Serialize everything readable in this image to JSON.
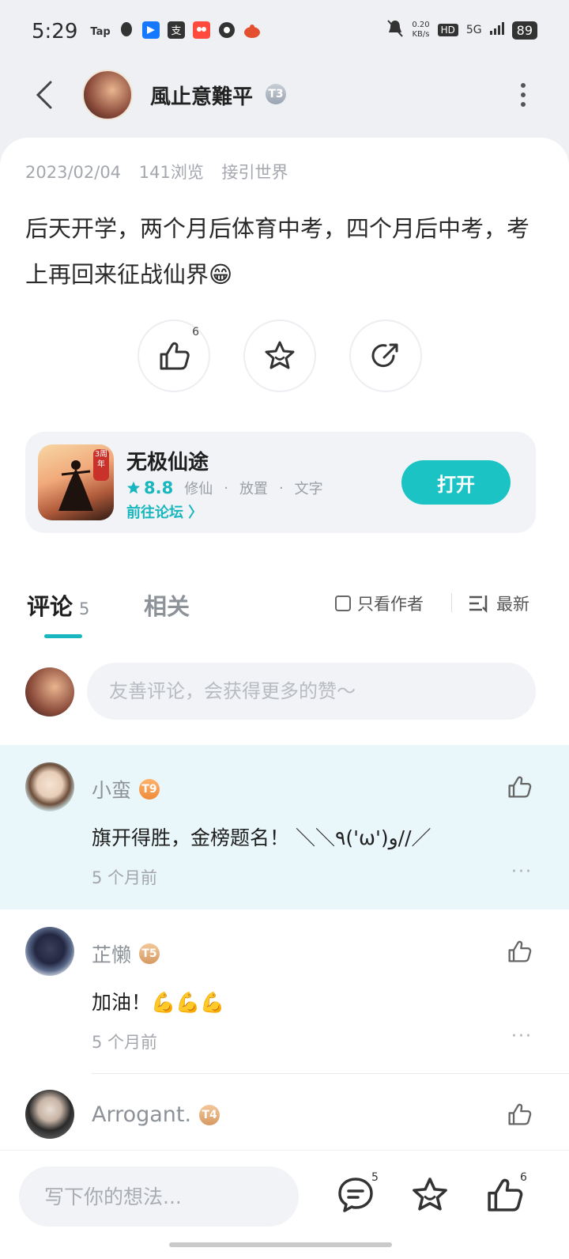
{
  "status_bar": {
    "time": "5:29",
    "app_icons": [
      "Tap",
      "QQ",
      "Alipay",
      "支",
      "Taobao",
      "Browser",
      "Game"
    ],
    "net_speed": "0.20",
    "net_unit": "KB/s",
    "hd": "HD",
    "signal": "5G",
    "battery": "89"
  },
  "header": {
    "username": "風止意難平",
    "badge": "T3"
  },
  "post": {
    "date": "2023/02/04",
    "views": "141浏览",
    "forum": "接引世界",
    "content": "后天开学，两个月后体育中考，四个月后中考，考上再回来征战仙界😁",
    "like_count": "6"
  },
  "game": {
    "name": "无极仙途",
    "rating": "8.8",
    "tags": [
      "修仙",
      "放置",
      "文字"
    ],
    "forum_link": "前往论坛 〉",
    "open_label": "打开",
    "anniversary": "3周年"
  },
  "comments_section": {
    "tab_comments": "评论",
    "tab_comments_count": "5",
    "tab_related": "相关",
    "filter_author": "只看作者",
    "sort_label": "最新",
    "input_placeholder": "友善评论，会获得更多的赞～"
  },
  "comments": [
    {
      "name": "小蛮",
      "badge": "T9",
      "text": "旗开得胜，金榜题名！ ＼＼٩('ω')و//／",
      "time": "5 个月前"
    },
    {
      "name": "芷懒",
      "badge": "T5",
      "text": "加油！💪💪💪",
      "time": "5 个月前"
    },
    {
      "name": "Arrogant.",
      "badge": "T4"
    }
  ],
  "bottom_bar": {
    "placeholder": "写下你的想法...",
    "comment_count": "5",
    "like_count": "6"
  },
  "colors": {
    "accent": "#1bc3c5",
    "highlight_bg": "#e9f7fa",
    "badge_orange": "#f08a3a"
  }
}
